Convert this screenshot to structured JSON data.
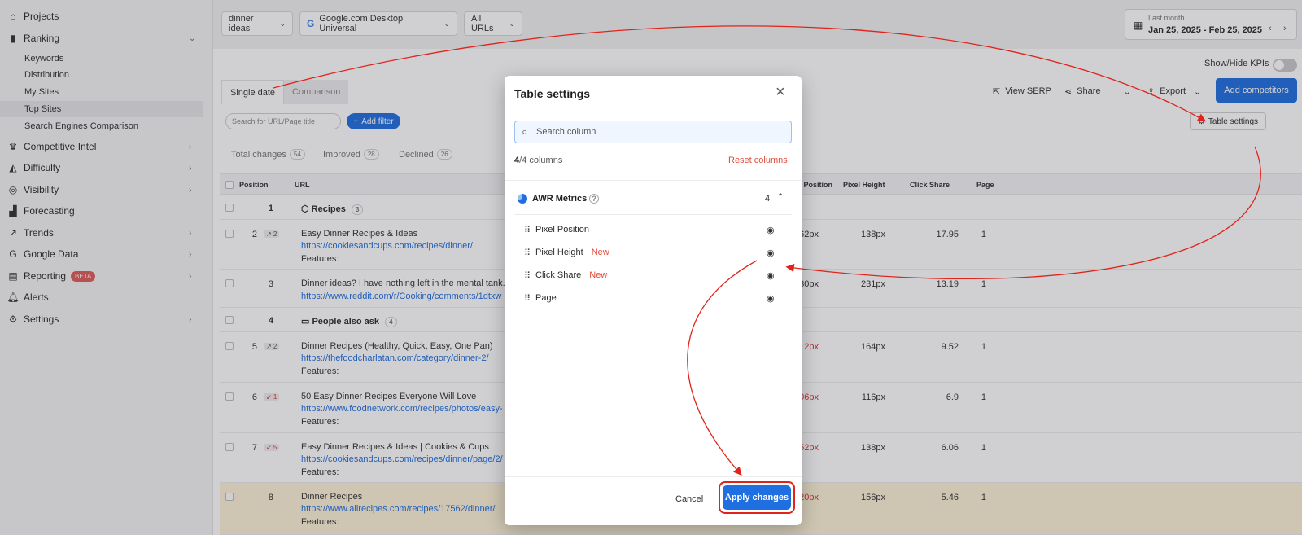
{
  "sidebar": {
    "items": [
      {
        "label": "Projects",
        "icon": "home-icon"
      },
      {
        "label": "Ranking",
        "icon": "bar-chart-icon"
      },
      {
        "label": "Competitive Intel",
        "icon": "trophy-icon"
      },
      {
        "label": "Difficulty",
        "icon": "difficulty-icon"
      },
      {
        "label": "Visibility",
        "icon": "visibility-icon"
      },
      {
        "label": "Forecasting",
        "icon": "forecast-icon"
      },
      {
        "label": "Trends",
        "icon": "trend-icon"
      },
      {
        "label": "Google Data",
        "icon": "google-icon"
      },
      {
        "label": "Reporting",
        "icon": "report-icon"
      },
      {
        "label": "Alerts",
        "icon": "bell-icon"
      },
      {
        "label": "Settings",
        "icon": "gear-icon"
      }
    ],
    "ranking_sub": [
      "Keywords",
      "Distribution",
      "My Sites",
      "Top Sites",
      "Search Engines Comparison"
    ],
    "beta_label": "BETA"
  },
  "topbar": {
    "keyword": "dinner ideas",
    "engine": "Google.com Desktop Universal",
    "urls": "All URLs",
    "date_caption": "Last month",
    "date_range": "Jan 25, 2025 - Feb 25, 2025"
  },
  "toolbar": {
    "kpi_label": "Show/Hide KPIs",
    "tab_single": "Single date",
    "tab_comparison": "Comparison",
    "view_serp": "View SERP",
    "share": "Share",
    "export": "Export",
    "add_competitors": "Add competitors",
    "search_placeholder": "Search for URL/Page title",
    "add_filter": "Add filter",
    "table_settings": "Table settings"
  },
  "summary": {
    "total_label": "Total changes",
    "total": "54",
    "improved_label": "Improved",
    "improved": "28",
    "declined_label": "Declined",
    "declined": "26"
  },
  "table": {
    "headers": {
      "position": "Position",
      "url": "URL",
      "pixel_position": "Pixel Position",
      "pixel_height": "Pixel Height",
      "click_share": "Click Share",
      "page": "Page"
    },
    "features_label": "Features:",
    "rows": [
      {
        "pos": "1",
        "group": "Recipes",
        "count": "3"
      },
      {
        "pos": "2",
        "change": "↗ 2",
        "title": "Easy Dinner Recipes & Ideas",
        "url": "https://cookiesandcups.com/recipes/dinner/",
        "pp": "562px",
        "ph": "138px",
        "cs": "17.95",
        "page": "1"
      },
      {
        "pos": "3",
        "title": "Dinner ideas? I have nothing left in the mental tank.",
        "url": "https://www.reddit.com/r/Cooking/comments/1dtxw",
        "pp": "730px",
        "ph": "231px",
        "cs": "13.19",
        "page": "1"
      },
      {
        "pos": "4",
        "group": "People also ask",
        "count": "4"
      },
      {
        "pos": "5",
        "change": "↗ 2",
        "title": "Dinner Recipes (Healthy, Quick, Easy, One Pan)",
        "url": "https://thefoodcharlatan.com/category/dinner-2/",
        "pp": "1312px",
        "ph": "164px",
        "cs": "9.52",
        "page": "1"
      },
      {
        "pos": "6",
        "change": "↙ 1",
        "title": "50 Easy Dinner Recipes Everyone Will Love",
        "url": "https://www.foodnetwork.com/recipes/photos/easy-",
        "pp": "1506px",
        "ph": "116px",
        "cs": "6.9",
        "page": "1"
      },
      {
        "pos": "7",
        "change": "↙ 5",
        "title": "Easy Dinner Recipes & Ideas | Cookies & Cups",
        "url": "https://cookiesandcups.com/recipes/dinner/page/2/",
        "pp": "1652px",
        "ph": "138px",
        "cs": "6.06",
        "page": "1"
      },
      {
        "pos": "8",
        "title": "Dinner Recipes",
        "url": "https://www.allrecipes.com/recipes/17562/dinner/",
        "pp": "1820px",
        "ph": "156px",
        "cs": "5.46",
        "page": "1"
      }
    ]
  },
  "modal": {
    "title": "Table settings",
    "search_placeholder": "Search column",
    "count_visible": "4",
    "count_total": "/4 columns",
    "reset": "Reset columns",
    "group_name": "AWR Metrics",
    "group_count": "4",
    "columns": [
      {
        "name": "Pixel Position",
        "new": ""
      },
      {
        "name": "Pixel Height",
        "new": "New"
      },
      {
        "name": "Click Share",
        "new": "New"
      },
      {
        "name": "Page",
        "new": ""
      }
    ],
    "cancel": "Cancel",
    "apply": "Apply changes"
  },
  "colors": {
    "accent": "#1f6fe0",
    "annotation": "#e0241b",
    "highlight_row": "#fdf1d6"
  }
}
